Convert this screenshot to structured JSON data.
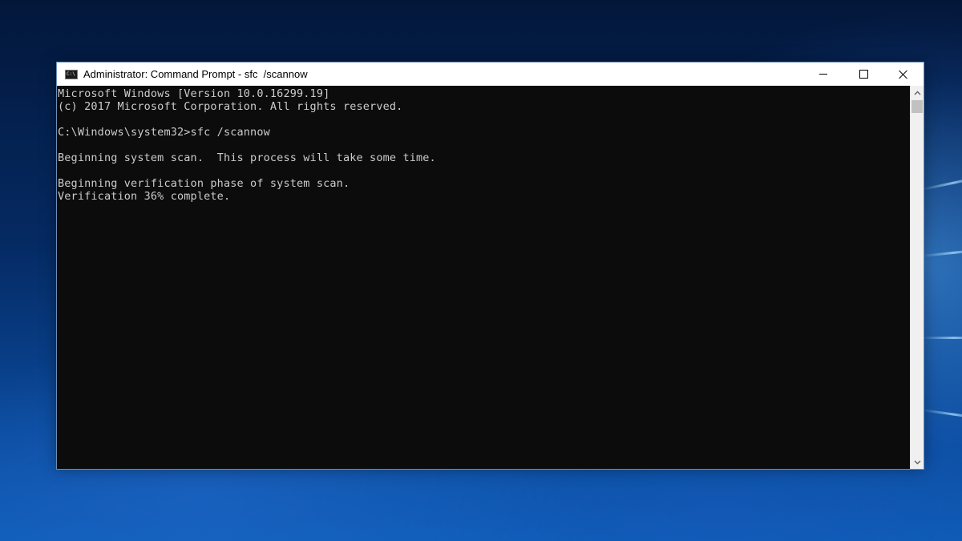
{
  "window": {
    "title": "Administrator: Command Prompt - sfc  /scannow",
    "icon": "cmd-app-icon",
    "controls": {
      "minimize": "minimize-icon",
      "maximize": "maximize-icon",
      "close": "close-icon"
    }
  },
  "console": {
    "background": "#0c0c0c",
    "foreground": "#cccccc",
    "lines": [
      "Microsoft Windows [Version 10.0.16299.19]",
      "(c) 2017 Microsoft Corporation. All rights reserved.",
      "",
      "C:\\Windows\\system32>sfc /scannow",
      "",
      "Beginning system scan.  This process will take some time.",
      "",
      "Beginning verification phase of system scan.",
      "Verification 36% complete."
    ]
  },
  "scrollbar": {
    "up_icon": "chevron-up-icon",
    "down_icon": "chevron-down-icon"
  }
}
